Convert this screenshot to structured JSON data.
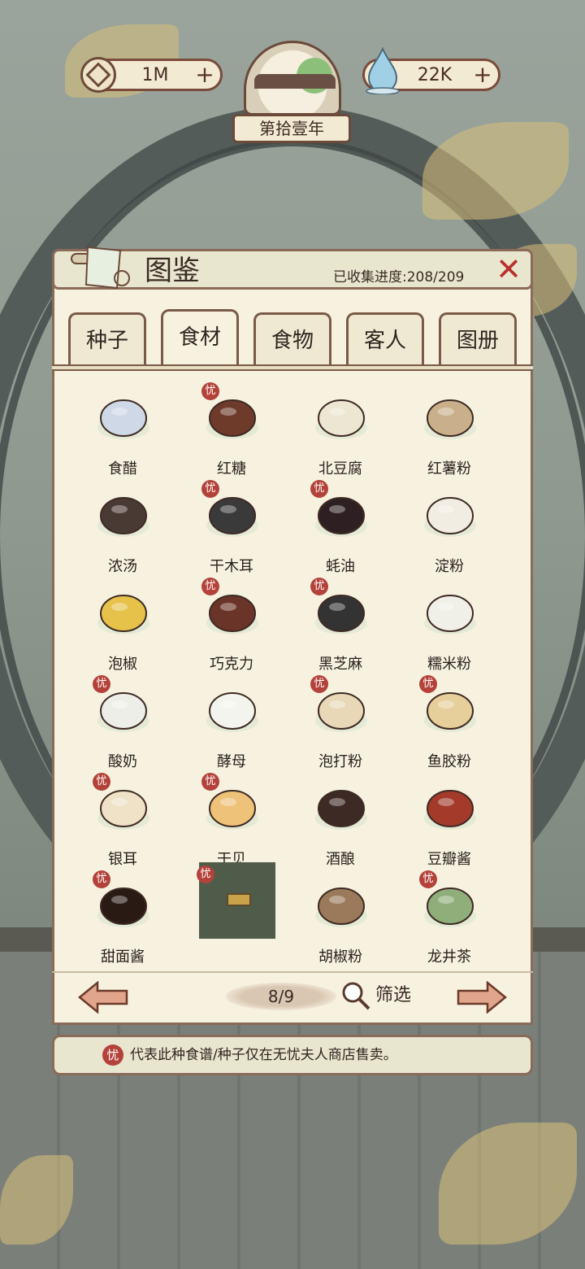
{
  "hud": {
    "coins": "1M",
    "water": "22K",
    "plus_symbol": "+",
    "year": "第拾壹年"
  },
  "codex": {
    "title": "图鉴",
    "progress": "已收集进度:208/209",
    "close_symbol": "✕",
    "tabs": [
      {
        "label": "种子",
        "active": false
      },
      {
        "label": "食材",
        "active": true
      },
      {
        "label": "食物",
        "active": false
      },
      {
        "label": "客人",
        "active": false
      },
      {
        "label": "图册",
        "active": false
      }
    ],
    "badge_char": "忧",
    "items": [
      {
        "name": "食醋",
        "exclusive": false
      },
      {
        "name": "红糖",
        "exclusive": true
      },
      {
        "name": "北豆腐",
        "exclusive": false
      },
      {
        "name": "红薯粉",
        "exclusive": false
      },
      {
        "name": "浓汤",
        "exclusive": false
      },
      {
        "name": "干木耳",
        "exclusive": true
      },
      {
        "name": "蚝油",
        "exclusive": true
      },
      {
        "name": "淀粉",
        "exclusive": false
      },
      {
        "name": "泡椒",
        "exclusive": false
      },
      {
        "name": "巧克力",
        "exclusive": true
      },
      {
        "name": "黑芝麻",
        "exclusive": true
      },
      {
        "name": "糯米粉",
        "exclusive": false
      },
      {
        "name": "酸奶",
        "exclusive": true
      },
      {
        "name": "酵母",
        "exclusive": false
      },
      {
        "name": "泡打粉",
        "exclusive": true
      },
      {
        "name": "鱼胶粉",
        "exclusive": true
      },
      {
        "name": "银耳",
        "exclusive": true
      },
      {
        "name": "干贝",
        "exclusive": true
      },
      {
        "name": "酒酿",
        "exclusive": false
      },
      {
        "name": "豆瓣酱",
        "exclusive": false
      },
      {
        "name": "甜面酱",
        "exclusive": true
      },
      {
        "name": "",
        "exclusive": true,
        "locked": true
      },
      {
        "name": "胡椒粉",
        "exclusive": false
      },
      {
        "name": "龙井茶",
        "exclusive": true
      }
    ],
    "pagination": {
      "page": "8/9",
      "filter_label": "筛选"
    },
    "hint": "代表此种食谱/种子仅在无忧夫人商店售卖。"
  },
  "colors": {
    "badge": "#b3423a",
    "close": "#b8302a",
    "panel": "#f7f2e0",
    "border": "#8a6a58"
  }
}
